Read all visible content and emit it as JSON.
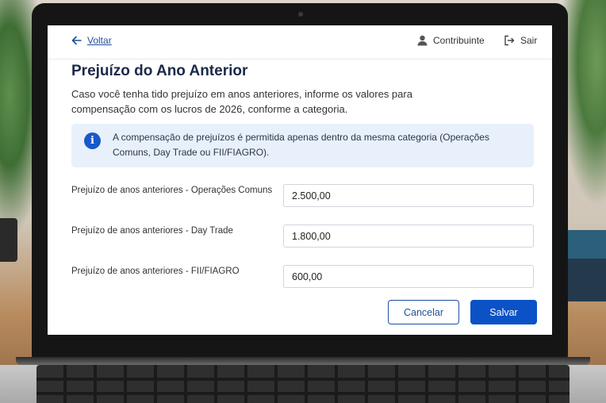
{
  "header": {
    "back_label": "Voltar",
    "user_label": "Contribuinte",
    "logout_label": "Sair"
  },
  "page": {
    "title": "Prejuízo do Ano Anterior",
    "description": "Caso você tenha tido prejuízo em anos anteriores, informe os valores para compensação com os lucros de 2026, conforme a categoria."
  },
  "info": {
    "icon": "info-icon",
    "text": "A compensação de prejuízos é permitida apenas dentro da mesma categoria (Operações Comuns, Day Trade ou FII/FIAGRO)."
  },
  "fields": [
    {
      "label": "Prejuízo de anos anteriores - Operações Comuns",
      "value": "2.500,00"
    },
    {
      "label": "Prejuízo de anos anteriores - Day Trade",
      "value": "1.800,00"
    },
    {
      "label": "Prejuízo de anos anteriores - FII/FIAGRO",
      "value": "600,00"
    }
  ],
  "actions": {
    "cancel_label": "Cancelar",
    "save_label": "Salvar"
  },
  "colors": {
    "primary": "#0b52c6",
    "info_background": "#e8f0fc",
    "title": "#1a2a4a"
  }
}
